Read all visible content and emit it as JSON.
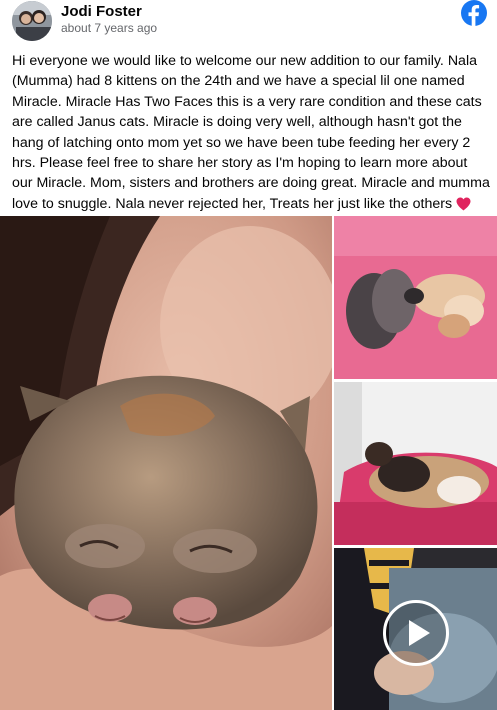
{
  "post": {
    "author": "Jodi Foster",
    "timestamp": "about 7 years ago",
    "text": "Hi everyone we would like to welcome our new addition to our family. Nala (Mumma) had 8 kittens on the 24th and we have a special lil one named Miracle. Miracle Has Two Faces this is a very rare condition and these cats are called Janus cats. Miracle is doing very well, although hasn't got the hang of latching onto mom yet so we have been tube feeding her every 2 hrs. Please feel free to share her story as I'm hoping to learn more about our Miracle. Mom, sisters and brothers are doing great. Miracle and mumma love to snuggle. Nala never rejected her, Treats her just like the others"
  },
  "icons": {
    "platform": "facebook-logo-icon",
    "emoji": "red-heart-icon",
    "video": "play-icon"
  },
  "colors": {
    "facebook_blue": "#1877f2",
    "heart_red": "#e0245e",
    "secondary_text": "#65676b"
  },
  "media": {
    "photos": [
      {
        "id": "main",
        "subject": "two-faced kitten held in hand"
      },
      {
        "id": "top-right",
        "subject": "kittens on pink blanket"
      },
      {
        "id": "middle-right",
        "subject": "mother cat nursing on pink bed"
      },
      {
        "id": "bottom-right",
        "subject": "video thumbnail",
        "is_video": true
      }
    ]
  }
}
